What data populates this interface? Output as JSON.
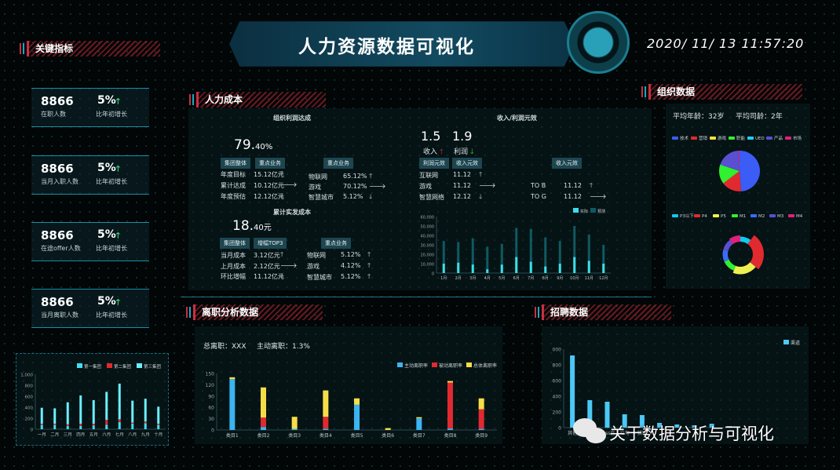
{
  "header": {
    "title": "人力资源数据可视化",
    "datetime": "2020/ 11/ 13 11:57:20"
  },
  "key_metrics": {
    "title": "关键指标",
    "cards": [
      {
        "value": "8866",
        "label": "在职人数",
        "pct": "5%",
        "pct_label": "比年初增长",
        "trend": "up"
      },
      {
        "value": "8866",
        "label": "当月入职人数",
        "pct": "5%",
        "pct_label": "比年初增长",
        "trend": "up"
      },
      {
        "value": "8866",
        "label": "在途offer人数",
        "pct": "5%",
        "pct_label": "比年初增长",
        "trend": "up"
      },
      {
        "value": "8866",
        "label": "当月离职人数",
        "pct": "5%",
        "pct_label": "比年初增长",
        "trend": "up"
      }
    ]
  },
  "hr_cost": {
    "title": "人力成本",
    "profit": {
      "title": "组织利润达成",
      "big": "79.",
      "big_small": "40%",
      "btn1": "集团整体",
      "btn2": "重点业务",
      "btn3": "重点业务",
      "rows": [
        {
          "k": "年度目标",
          "v": "15.12亿元",
          "t": "up"
        },
        {
          "k": "累计达成",
          "v": "10.12亿元",
          "t": "flat"
        },
        {
          "k": "年度预估",
          "v": "12.12亿元",
          "t": "down"
        }
      ],
      "rows2": [
        {
          "k": "物联网",
          "v": "65.12%",
          "t": "up"
        },
        {
          "k": "游戏",
          "v": "70.12%",
          "t": "flat"
        },
        {
          "k": "智慧城市",
          "v": "5.12%",
          "t": "down"
        }
      ]
    },
    "cost": {
      "title": "累计实发成本",
      "big": "18.",
      "big_small": "40元",
      "btn1": "集团整体",
      "btn2": "增幅TOP3",
      "btn3": "重点业务",
      "rows": [
        {
          "k": "当月成本",
          "v": "3.12亿元",
          "t": "up"
        },
        {
          "k": "上月成本",
          "v": "2.12亿元",
          "t": "flat"
        },
        {
          "k": "环比增幅",
          "v": "11.12亿元",
          "t": "down"
        }
      ],
      "rows2": [
        {
          "k": "物联网",
          "v": "5.12%",
          "t": "up"
        },
        {
          "k": "游戏",
          "v": "4.12%",
          "t": "up"
        },
        {
          "k": "智慧城市",
          "v": "5.12%",
          "t": "up"
        }
      ]
    },
    "efficiency": {
      "title": "收入/利润元效",
      "income": "1.5",
      "income_label": "收入",
      "income_trend": "up",
      "profit": "1.9",
      "profit_label": "利润",
      "profit_trend": "down",
      "btn1": "利润元效",
      "btn2": "收入元效",
      "btn3": "收入元效",
      "rows": [
        {
          "k": "互联网",
          "v": "11.12",
          "t": "up"
        },
        {
          "k": "游戏",
          "v": "11.12",
          "t": "flat"
        },
        {
          "k": "智慧网络",
          "v": "12.12",
          "t": "down"
        }
      ],
      "rows2": [
        {
          "k": "TO B",
          "v": "11.12",
          "t": "up"
        },
        {
          "k": "TO G",
          "v": "11.12",
          "t": "flat"
        }
      ]
    }
  },
  "org": {
    "title": "组织数据",
    "avg_age": "平均年龄：32岁",
    "avg_tenure": "平均司龄：2年"
  },
  "attrition": {
    "title": "离职分析数据",
    "total": "总离职：XXX",
    "active": "主动离职：1.3%"
  },
  "recruit": {
    "title": "招聘数据"
  },
  "watermark": "关于数据分析与可视化",
  "chart_data": [
    {
      "id": "group-headcount",
      "type": "bar",
      "stacked": true,
      "categories": [
        "一月",
        "二月",
        "三月",
        "四月",
        "五月",
        "六月",
        "七月",
        "八月",
        "九月",
        "十月"
      ],
      "series": [
        {
          "name": "第一集团",
          "color": "#40e0f0",
          "values": [
            80,
            80,
            60,
            60,
            70,
            80,
            130,
            100,
            110,
            80
          ]
        },
        {
          "name": "第二集团",
          "color": "#e02a30",
          "values": [
            20,
            20,
            30,
            40,
            30,
            90,
            50,
            20,
            30,
            20
          ]
        },
        {
          "name": "第三集团",
          "color": "#6af0ff",
          "values": [
            290,
            280,
            400,
            515,
            430,
            510,
            650,
            400,
            415,
            310
          ]
        }
      ],
      "ylim": [
        0,
        1000
      ],
      "yticks": [
        0,
        200,
        400,
        600,
        800,
        1000
      ],
      "ytick_labels": [
        "0",
        "200",
        "400",
        "600",
        "800",
        "1,000"
      ],
      "legend": "top-right"
    },
    {
      "id": "income-monthly",
      "type": "bar",
      "overlay": true,
      "categories": [
        "1月",
        "2月",
        "3月",
        "4月",
        "5月",
        "6月",
        "7月",
        "8月",
        "9月",
        "10月",
        "11月",
        "12月"
      ],
      "series": [
        {
          "name": "预测",
          "color": "#0f5a62",
          "values": [
            34000,
            33000,
            37000,
            28000,
            31000,
            48000,
            47000,
            38000,
            34000,
            50000,
            41000,
            30000
          ]
        },
        {
          "name": "实际",
          "color": "#3adfe8",
          "values": [
            10000,
            11000,
            9000,
            4000,
            9000,
            17000,
            12000,
            7000,
            10000,
            17000,
            13000,
            10000
          ]
        }
      ],
      "legend_order": [
        "实际",
        "预测"
      ],
      "ylim": [
        0,
        60000
      ],
      "yticks": [
        0,
        10000,
        20000,
        30000,
        40000,
        50000,
        60000
      ],
      "ytick_labels": [
        "0",
        "10,000",
        "20,000",
        "30,000",
        "40,000",
        "50,000",
        "60,000"
      ],
      "legend": "top-right"
    },
    {
      "id": "dept-pie",
      "type": "pie",
      "labels": [
        "技术",
        "营销",
        "游戏",
        "职能",
        "UED",
        "产品",
        "市场"
      ],
      "colors": [
        "#3b5cf5",
        "#e02a30",
        "#f2e040",
        "#30f030",
        "#20d0f0",
        "#5a4fd0",
        "#e0207a"
      ],
      "values": [
        49,
        16,
        0.3,
        15,
        0.3,
        19,
        0.8
      ],
      "legend": "top"
    },
    {
      "id": "level-donut",
      "type": "pie",
      "donut": true,
      "labels": [
        "P3以下",
        "P4",
        "P5",
        "M1",
        "M2",
        "M3",
        "M4"
      ],
      "colors": [
        "#10c8f0",
        "#e02a30",
        "#eef050",
        "#30f030",
        "#3b6cf5",
        "#5a4fd0",
        "#e0207a"
      ],
      "values": [
        10,
        26,
        20,
        12,
        11,
        11,
        10
      ],
      "radius_scale": [
        0.75,
        1,
        0.85,
        0.75,
        0.75,
        0.75,
        0.8
      ],
      "legend": "top"
    },
    {
      "id": "attrition-bar",
      "type": "bar",
      "stacked": true,
      "categories": [
        "类目1",
        "类目2",
        "类目3",
        "类目4",
        "类目5",
        "类目6",
        "类目7",
        "类目8",
        "类目9"
      ],
      "series": [
        {
          "name": "主动离职率",
          "color": "#3ab4f2",
          "values": [
            135,
            8,
            3,
            3,
            67,
            0,
            31,
            4,
            3
          ]
        },
        {
          "name": "被动离职率",
          "color": "#e02a30",
          "values": [
            0,
            25,
            0,
            32,
            0,
            0,
            0,
            122,
            52
          ]
        },
        {
          "name": "总体离职率",
          "color": "#f6dd48",
          "values": [
            5,
            80,
            32,
            70,
            17,
            5,
            3,
            4,
            29
          ]
        }
      ],
      "ylim": [
        0,
        150
      ],
      "yticks": [
        0,
        30,
        60,
        90,
        120,
        150
      ],
      "ytick_labels": [
        "0",
        "30",
        "60",
        "90",
        "120",
        "150"
      ],
      "legend": "top-right"
    },
    {
      "id": "recruit-channel",
      "type": "bar",
      "categories": [
        "其他",
        "内推",
        "boss直",
        "拉勾",
        "猎聘",
        "",
        "",
        "",
        "",
        ""
      ],
      "series": [
        {
          "name": "渠道",
          "color": "#4cc8f4",
          "values": [
            920,
            350,
            330,
            170,
            160,
            60,
            40,
            30,
            50,
            20
          ]
        }
      ],
      "ylim": [
        0,
        1000
      ],
      "yticks": [
        0,
        200,
        400,
        600,
        800,
        1000
      ],
      "ytick_labels": [
        "0",
        "200",
        "400",
        "600",
        "800",
        "000"
      ],
      "legend": "top-right"
    }
  ]
}
